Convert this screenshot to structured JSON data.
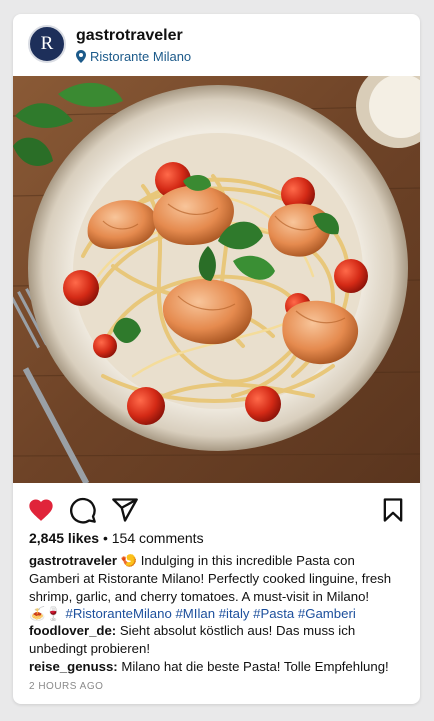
{
  "post": {
    "username": "gastrotraveler",
    "avatar_letter": "R",
    "location": "Ristorante Milano",
    "likes_count": "2,845 likes",
    "separator": " • ",
    "comments_count": "154 comments",
    "caption": {
      "username": "gastrotraveler",
      "emoji_1": "🍤",
      "text": " Indulging in this incredible Pasta con Gamberi at Ristorante Milano! Perfectly cooked linguine, fresh shrimp, garlic, and cherry tomatoes. A must-visit in Milano!",
      "emoji_2": "🍝🍷",
      "hashtags": "#RistoranteMilano #MIlan #italy #Pasta #Gamberi"
    },
    "comments": [
      {
        "username": "foodlover_de:",
        "text": " Sieht absolut köstlich aus! Das muss ich unbedingt probieren!"
      },
      {
        "username": "reise_genuss:",
        "text": " Milano hat die beste Pasta! Tolle Empfehlung!"
      }
    ],
    "timestamp": "2 HOURS AGO"
  },
  "icons": {
    "location": "location-pin-icon",
    "like": "heart-icon",
    "comment": "comment-icon",
    "share": "send-icon",
    "save": "bookmark-icon"
  },
  "colors": {
    "heart": "#e0243a",
    "location_text": "#1c5a8a",
    "hashtags": "#1c4f9c",
    "avatar_bg": "#1d2f5a"
  }
}
